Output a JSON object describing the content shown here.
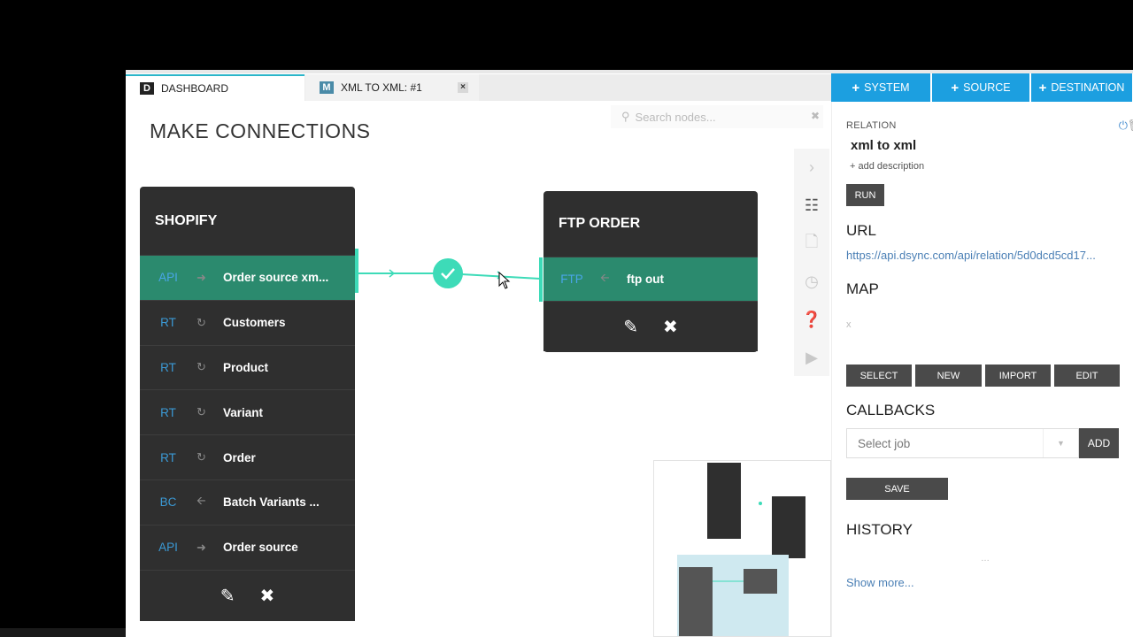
{
  "tabs": [
    {
      "letter": "D",
      "label": "DASHBOARD"
    },
    {
      "letter": "M",
      "label": "XML TO XML: #1",
      "close": "×"
    }
  ],
  "top_buttons": [
    {
      "label": "SYSTEM"
    },
    {
      "label": "SOURCE"
    },
    {
      "label": "DESTINATION"
    }
  ],
  "canvas": {
    "title": "MAKE CONNECTIONS",
    "search_placeholder": "Search nodes...",
    "source_node": {
      "title": "SHOPIFY",
      "rows": [
        {
          "tag": "API",
          "label": "Order source xm..."
        },
        {
          "tag": "RT",
          "label": "Customers"
        },
        {
          "tag": "RT",
          "label": "Product"
        },
        {
          "tag": "RT",
          "label": "Variant"
        },
        {
          "tag": "RT",
          "label": "Order"
        },
        {
          "tag": "BC",
          "label": "Batch Variants ..."
        },
        {
          "tag": "API",
          "label": "Order source"
        }
      ]
    },
    "dest_node": {
      "title": "FTP ORDER",
      "rows": [
        {
          "tag": "FTP",
          "label": "ftp out"
        }
      ]
    }
  },
  "panel": {
    "relation_label": "RELATION",
    "relation_name": "xml to xml",
    "add_description": "add description",
    "run_label": "RUN",
    "url_heading": "URL",
    "url_value": "https://api.dsync.com/api/relation/5d0dcd5cd17...",
    "map_heading": "MAP",
    "map_value": "x",
    "map_buttons": [
      "SELECT",
      "NEW",
      "IMPORT",
      "EDIT"
    ],
    "callbacks_heading": "CALLBACKS",
    "select_job_placeholder": "Select job",
    "add_label": "ADD",
    "save_label": "SAVE",
    "history_heading": "HISTORY",
    "show_more": "Show more..."
  },
  "colors": {
    "accent_blue": "#1c9fe0",
    "connector_teal": "#3ddbb8",
    "selected_row": "#2b8a6e",
    "node_bg": "#2f2f2f",
    "link": "#4a7fb5"
  }
}
